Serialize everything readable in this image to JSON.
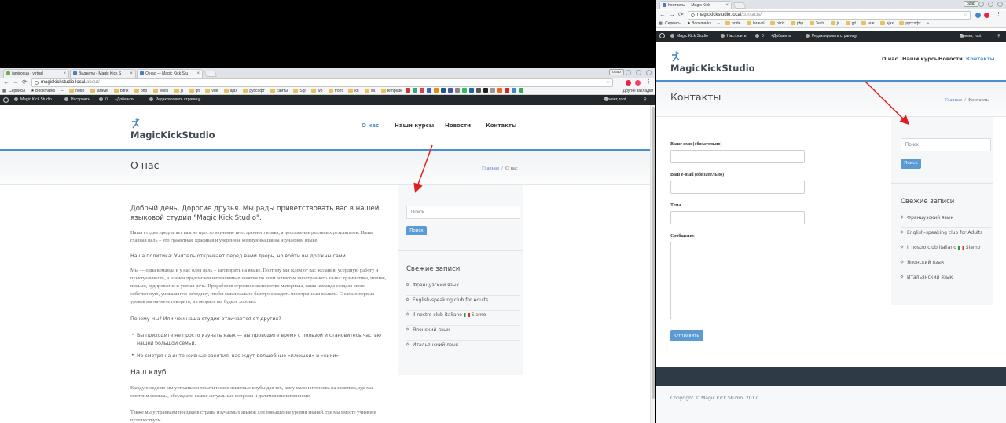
{
  "left_window": {
    "tabs": [
      {
        "label": "jamiroqua - virtual"
      },
      {
        "label": "Виджеты ‹ Magic Kick S"
      },
      {
        "label": "О нас — Magic Kick Stu"
      }
    ],
    "profile_label": "ozap",
    "address": {
      "host": "magickickstudio.local",
      "path": "/about/"
    },
    "bookmarks": [
      "Сервисы",
      "Bookmarks",
      "node",
      "laravel",
      "bitrix",
      "php",
      "Tests",
      "js",
      "git",
      "vue",
      "ajax",
      "руссофт",
      "сайты",
      "Sql",
      "wp",
      "front",
      "kh",
      "xa",
      "template"
    ],
    "bookmarks_other": "Другие закладки",
    "wp_admin": {
      "site": "Magic Kick Studio",
      "customize": "Настроить",
      "comments": "0",
      "new": "Добавить",
      "edit": "Редактировать страницу",
      "greeting": "Привет, root"
    },
    "site": {
      "logo": "MagicKickStudio",
      "nav": [
        {
          "label": "О нас",
          "active": true
        },
        {
          "label": "Наши курсы",
          "active": false
        },
        {
          "label": "Новости",
          "active": false
        },
        {
          "label": "Контакты",
          "active": false
        }
      ],
      "page_title": "О нас",
      "breadcrumb": {
        "home": "Главная",
        "sep": "/",
        "current": "О нас"
      },
      "lead": "Добрый день, Дорогие друзья. Мы рады приветствовать вас в нашей языковой студии \"Magic Kick Studio\".",
      "p1": "Наша студия предлагает вам не просто изучение иностранного языка, а достижение реальных результатов. Наша главная цель – это грамотная, красивая и уверенная коммуникация на изучаемом языке.",
      "p2": "Наша политика: Учитель открывает перед вами дверь, но войти вы должны сами",
      "p3": "Мы — одна команда и у нас одна цель – заговорить на языке. Поэтому мы ждем от вас желания, усердную работу и пунктуальность, а взамен предлагаем интенсивные занятия по всем аспектам иностранного языка: грамматика, чтение, письмо, аудирование и устная речь. Проработав огромное количество материала, наша команда создала свою собственную, уникальную методику, чтобы максимально быстро овладеть иностранным языком. С самых первых уроков вы начнете говорить, и говорить вы будете хорошо.",
      "p4": "Почему мы? Или чем наша студия отличается от других?",
      "bullets": [
        "Вы приходите не просто изучать язык — вы проводите время с пользой и становитесь частью нашей большой семьи.",
        "Не смотря на интенсивные занятия, вас ждут волшебные «плюшки» и «кики»"
      ],
      "h_club": "Наш клуб",
      "p5": "Каждую неделю мы устраиваем тематические языковые клубы для тех, кому мало интенсива на занятиях, где мы смотрим фильмы, обсуждаем самые актуальные вопросы и делимся впечатлениями.",
      "p6": "Также мы устраиваем поездки в страны изучаемых языков для повышения уровня знаний, где мы вместе учимся и путешествуем.",
      "search_placeholder": "Поиск",
      "search_button": "Поиск",
      "recent_title": "Свежие записи",
      "recent": [
        "Французский язык",
        "English-speaking club for Adults",
        "Il nostro club italiano",
        "Японский язык",
        "Итальянский язык"
      ],
      "recent_suffix": "Siamo"
    }
  },
  "right_window": {
    "tabs": [
      {
        "label": "Контакты — Magic Kick"
      }
    ],
    "profile_label": "ozap",
    "address": {
      "host": "magickickstudio.local",
      "path": "/contacts/"
    },
    "bookmarks": [
      "Сервисы",
      "Bookmarks",
      "node",
      "laravel",
      "bitrix",
      "php",
      "Tests",
      "js",
      "git",
      "vue",
      "ajax",
      "руссофт"
    ],
    "wp_admin": {
      "site": "Magic Kick Studio",
      "customize": "Настроить",
      "comments": "0",
      "new": "Добавить",
      "edit": "Редактировать страницу",
      "greeting": "Привет, root"
    },
    "site": {
      "logo": "MagicKickStudio",
      "nav": [
        {
          "label": "О нас",
          "active": false
        },
        {
          "label": "Наши курсы",
          "active": false
        },
        {
          "label": "Новости",
          "active": false
        },
        {
          "label": "Контакты",
          "active": true
        }
      ],
      "page_title": "Контакты",
      "breadcrumb": {
        "home": "Главная",
        "sep": "/",
        "current": "Контакты"
      },
      "form": {
        "name_label": "Ваше имя (обязательно)",
        "email_label": "Ваш e-mail (обязательно)",
        "subject_label": "Тема",
        "message_label": "Сообщение",
        "submit": "Отправить"
      },
      "search_placeholder": "Поиск",
      "search_button": "Поиск",
      "recent_title": "Свежие записи",
      "recent": [
        "Французский язык",
        "English-speaking club for Adults",
        "Il nostro club italiano",
        "Японский язык",
        "Итальянский язык"
      ],
      "recent_suffix": "Siamo",
      "copyright": "Copyright © Magic Kick Studio, 2017"
    }
  },
  "colors": {
    "accent": "#4a90d0",
    "arrow": "#e02020",
    "wp_bar": "#23282d",
    "footer": "#2e3a46"
  }
}
